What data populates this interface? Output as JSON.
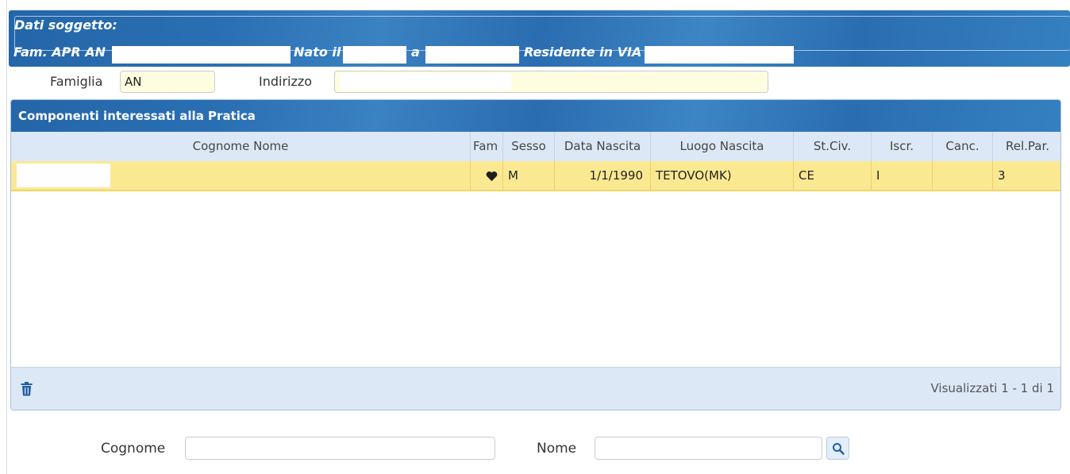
{
  "header": {
    "title": "Dati soggetto:",
    "fam_label": "Fam. APR AN",
    "nato_label": "Nato il",
    "a_label": "a",
    "residente_label": "Residente in VIA"
  },
  "fields": {
    "famiglia_label": "Famiglia",
    "famiglia_value": "AN",
    "indirizzo_label": "Indirizzo",
    "indirizzo_value": "'"
  },
  "panel": {
    "title": "Componenti interessati alla Pratica",
    "columns": [
      "Cognome Nome",
      "Fam",
      "Sesso",
      "Data Nascita",
      "Luogo Nascita",
      "St.Civ.",
      "Iscr.",
      "Canc.",
      "Rel.Par."
    ],
    "rows": [
      {
        "cognome_nome": "",
        "fam_icon": "heart-icon",
        "sesso": "M",
        "data_nascita": "1/1/1990",
        "luogo_nascita": "TETOVO(MK)",
        "st_civ": "CE",
        "iscr": "I",
        "canc": "",
        "rel_par": "3"
      }
    ],
    "pager": "Visualizzati 1 - 1 di 1",
    "delete_icon": "trash-icon"
  },
  "search": {
    "cognome_label": "Cognome",
    "cognome_value": "",
    "nome_label": "Nome",
    "nome_value": "",
    "button_icon": "search-icon"
  },
  "colors": {
    "header_blue": "#2a6fb3",
    "row_selected": "#fbe992",
    "column_header_bg": "#dde8f6",
    "input_yellow": "#fffde0"
  }
}
